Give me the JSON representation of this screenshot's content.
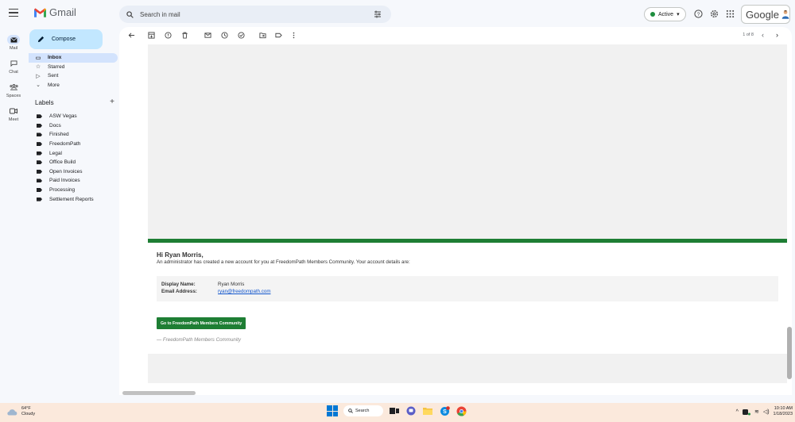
{
  "header": {
    "logo_text": "Gmail",
    "search_placeholder": "Search in mail",
    "status": "Active",
    "google_label": "Google"
  },
  "rail": [
    {
      "label": "Mail",
      "icon": "mail-icon"
    },
    {
      "label": "Chat",
      "icon": "chat-icon"
    },
    {
      "label": "Spaces",
      "icon": "spaces-icon"
    },
    {
      "label": "Meet",
      "icon": "meet-icon"
    }
  ],
  "compose_label": "Compose",
  "nav": [
    {
      "label": "Inbox",
      "icon": "inbox-icon"
    },
    {
      "label": "Starred",
      "icon": "star-icon"
    },
    {
      "label": "Sent",
      "icon": "sent-icon"
    },
    {
      "label": "More",
      "icon": "chevron-down-icon"
    }
  ],
  "labels_header": "Labels",
  "labels": [
    "ASW Vegas",
    "Docs",
    "Finished",
    "FreedomPath",
    "Legal",
    "Office Build",
    "Open Invoices",
    "Paid Invoices",
    "Processing",
    "Settlement Reports"
  ],
  "pager": "1 of 8",
  "email": {
    "greeting": "Hi Ryan Morris,",
    "intro": "An administrator has created a new account for you at FreedomPath Members Community. Your account details are:",
    "display_name_key": "Display Name:",
    "display_name_val": "Ryan Morris",
    "email_key": "Email Address:",
    "email_val": "ryan@freedompath.com",
    "cta": "Go to FreedomPath Members Community",
    "signature": "— FreedomPath Members Community"
  },
  "taskbar": {
    "temp": "64°F",
    "condition": "Cloudy",
    "search_label": "Search",
    "time": "10:10 AM",
    "date": "1/18/2023"
  },
  "colors": {
    "accent_green": "#1e7e34",
    "compose_bg": "#c2e7ff",
    "active_nav": "#d3e3fd"
  }
}
